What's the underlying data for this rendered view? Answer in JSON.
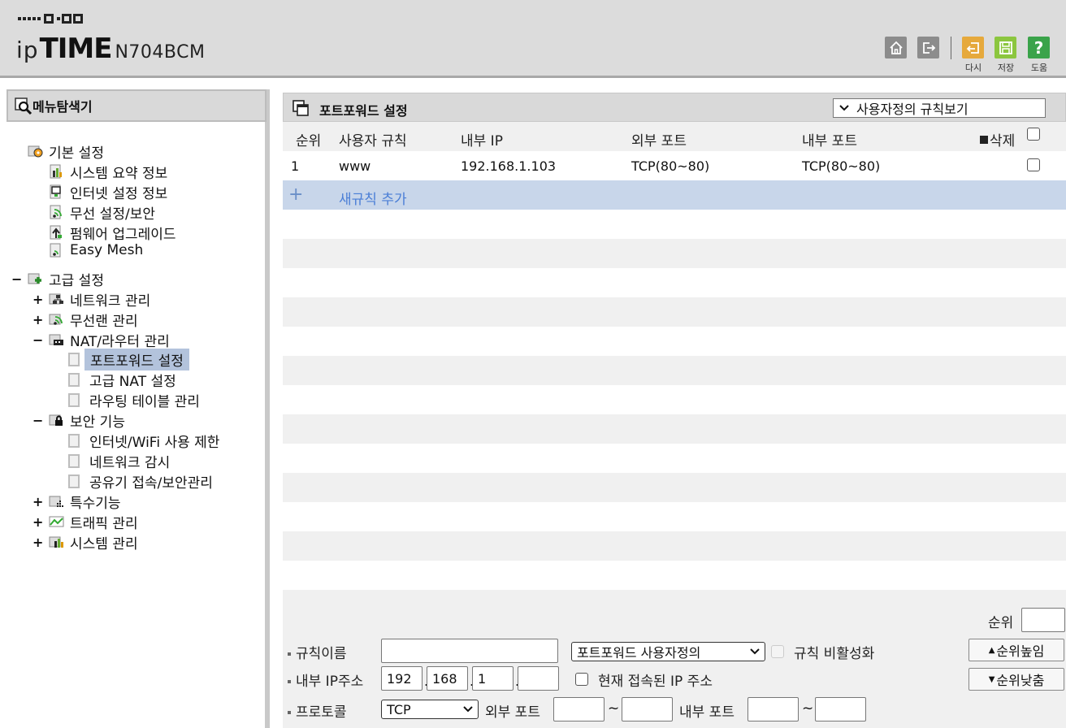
{
  "header": {
    "brand_prefix": "ip",
    "brand_main": "TIME",
    "model": "N704BCM",
    "buttons": [
      {
        "name": "home",
        "icon": "home-icon",
        "color": "#8c8c8c"
      },
      {
        "name": "logout",
        "icon": "logout-icon",
        "color": "#8c8c8c"
      },
      {
        "name": "refresh",
        "icon": "refresh-icon",
        "color": "#e6a93c",
        "label": "다시"
      },
      {
        "name": "save",
        "icon": "save-icon",
        "color": "#8cc63f",
        "label": "저장"
      },
      {
        "name": "help",
        "icon": "help-icon",
        "color": "#3aa34a",
        "label": "도움"
      }
    ]
  },
  "sidebar": {
    "title": "메뉴탐색기",
    "basic": {
      "label": "기본 설정",
      "items": [
        "시스템 요약 정보",
        "인터넷 설정 정보",
        "무선 설정/보안",
        "펌웨어 업그레이드",
        "Easy Mesh"
      ]
    },
    "advanced": {
      "label": "고급 설정",
      "network": "네트워크 관리",
      "wireless": "무선랜 관리",
      "nat": {
        "label": "NAT/라우터 관리",
        "items": [
          "포트포워드 설정",
          "고급 NAT 설정",
          "라우팅 테이블 관리"
        ]
      },
      "security": {
        "label": "보안 기능",
        "items": [
          "인터넷/WiFi 사용 제한",
          "네트워크 감시",
          "공유기 접속/보안관리"
        ]
      },
      "special": "특수기능",
      "traffic": "트래픽 관리",
      "system": "시스템 관리"
    }
  },
  "main": {
    "title": "포트포워드 설정",
    "view_select": "사용자정의 규칙보기",
    "columns": {
      "rank": "순위",
      "rule": "사용자 규칙",
      "internal_ip": "내부 IP",
      "external_port": "외부 포트",
      "internal_port": "내부 포트",
      "delete": "삭제"
    },
    "rules": [
      {
        "rank": "1",
        "name": "www",
        "internal_ip": "192.168.1.103",
        "external_port": "TCP(80~80)",
        "internal_port": "TCP(80~80)"
      }
    ],
    "new_rule": "새규칙 추가"
  },
  "form": {
    "rule_name_label": "규칙이름",
    "rule_name_value": "",
    "type_select": "포트포워드 사용자정의",
    "disable_label": "규칙 비활성화",
    "internal_ip_label": "내부 IP주소",
    "ip": [
      "192",
      "168",
      "1",
      ""
    ],
    "current_ip_label": "현재 접속된 IP 주소",
    "protocol_label": "프로토콜",
    "protocol_value": "TCP",
    "external_port_label": "외부 포트",
    "internal_port_label": "내부 포트",
    "rank_label": "순위",
    "rank_up": "순위높임",
    "rank_down": "순위낮춤"
  }
}
